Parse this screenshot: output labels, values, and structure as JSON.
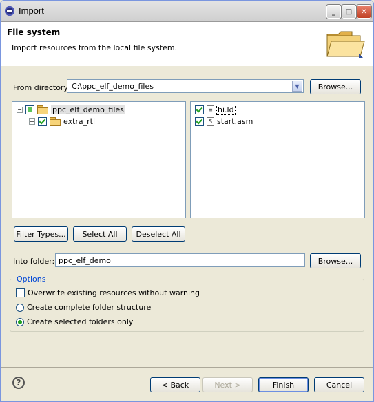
{
  "window": {
    "title": "Import"
  },
  "header": {
    "title": "File system",
    "description": "Import resources from the local file system."
  },
  "from_directory": {
    "label": "From directory:",
    "value": "C:\\ppc_elf_demo_files",
    "browse_label": "Browse..."
  },
  "folder_tree": {
    "items": [
      {
        "label": "ppc_elf_demo_files",
        "state": "partial"
      },
      {
        "label": "extra_rtl",
        "state": "checked"
      }
    ]
  },
  "file_list": {
    "items": [
      {
        "label": "hi.ld",
        "state": "checked"
      },
      {
        "label": "start.asm",
        "state": "checked"
      }
    ]
  },
  "selection_buttons": {
    "filter_types": "Filter Types...",
    "select_all": "Select All",
    "deselect_all": "Deselect All"
  },
  "into_folder": {
    "label": "Into folder:",
    "value": "ppc_elf_demo",
    "browse_label": "Browse..."
  },
  "options": {
    "label": "Options",
    "overwrite": "Overwrite existing resources without warning",
    "complete_structure": "Create complete folder structure",
    "selected_only": "Create selected folders only"
  },
  "footer": {
    "back": "< Back",
    "next": "Next >",
    "finish": "Finish",
    "cancel": "Cancel"
  }
}
